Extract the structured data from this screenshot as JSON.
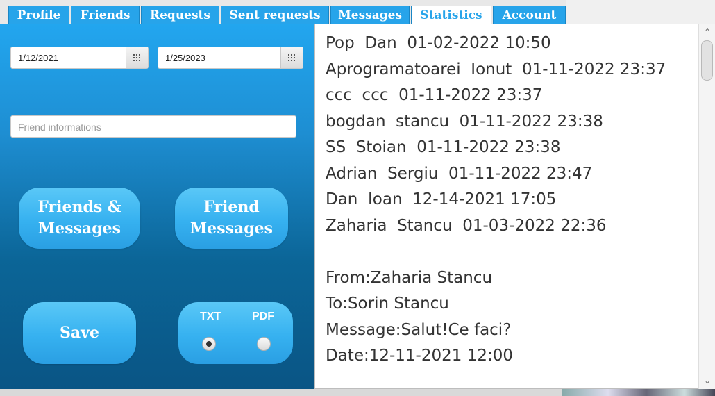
{
  "tabs": [
    {
      "label": "Profile"
    },
    {
      "label": "Friends"
    },
    {
      "label": "Requests"
    },
    {
      "label": "Sent requests"
    },
    {
      "label": "Messages"
    },
    {
      "label": "Statistics",
      "active": true
    },
    {
      "label": "Account"
    }
  ],
  "filters": {
    "date_from": "1/12/2021",
    "date_to": "1/25/2023",
    "friend_placeholder": "Friend informations"
  },
  "buttons": {
    "friends_messages_line1": "Friends &",
    "friends_messages_line2": "Messages",
    "friend_messages_line1": "Friend",
    "friend_messages_line2": "Messages",
    "save": "Save"
  },
  "export": {
    "txt_label": "TXT",
    "pdf_label": "PDF",
    "selected": "TXT"
  },
  "output": {
    "lines": [
      "Pop  Dan  01-02-2022 10:50",
      "Aprogramatoarei  Ionut  01-11-2022 23:37",
      "ccc  ccc  01-11-2022 23:37",
      "bogdan  stancu  01-11-2022 23:38",
      "SS  Stoian  01-11-2022 23:38",
      "Adrian  Sergiu  01-11-2022 23:47",
      "Dan  Ioan  12-14-2021 17:05",
      "Zaharia  Stancu  01-03-2022 22:36",
      "",
      "From:Zaharia Stancu",
      "To:Sorin Stancu",
      "Message:Salut!Ce faci?",
      "Date:12-11-2021 12:00"
    ]
  },
  "colors": {
    "accent": "#27a4ea",
    "panel_top": "#22a6ef",
    "panel_bottom": "#0a5585"
  }
}
